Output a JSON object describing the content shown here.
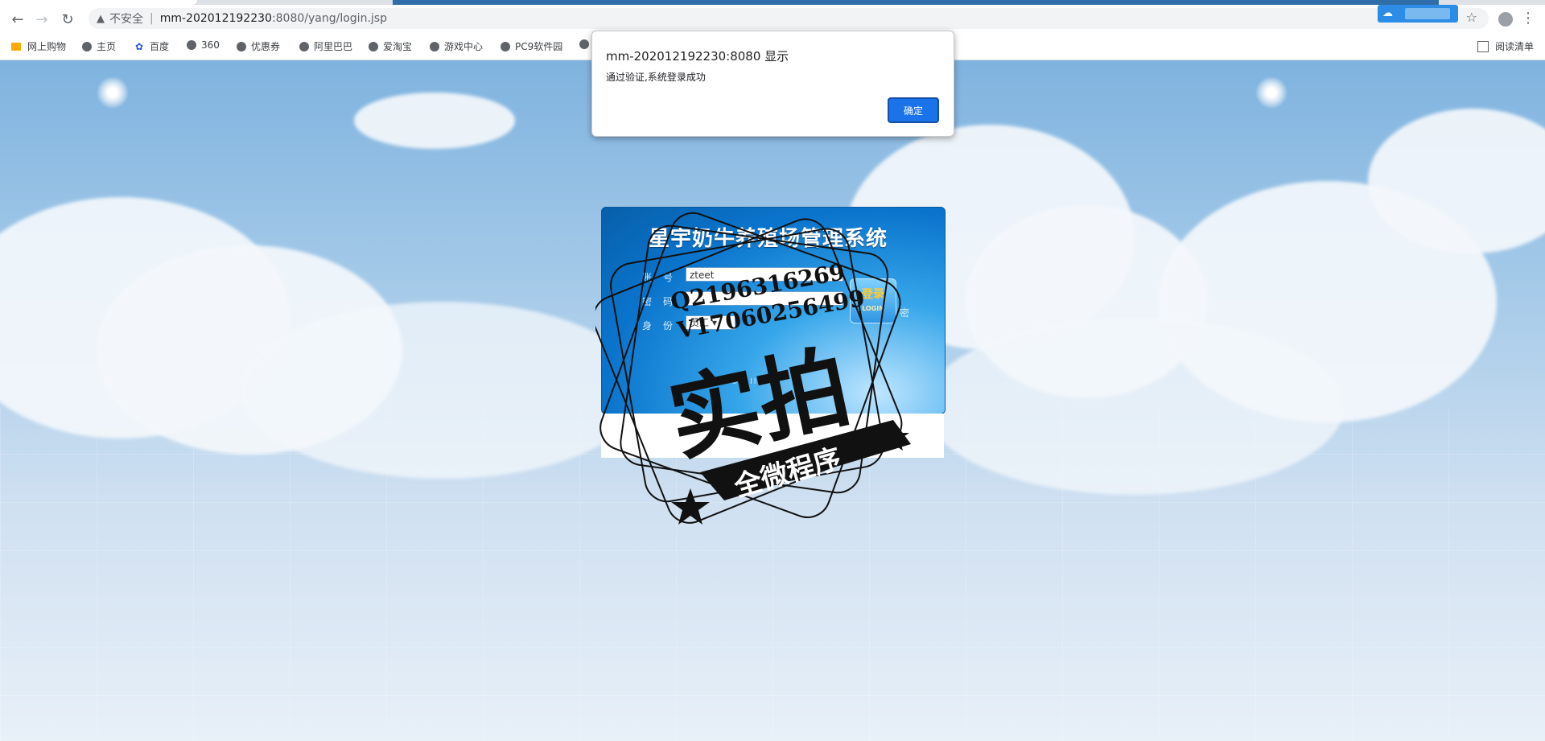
{
  "browser": {
    "security_label": "不安全",
    "url_host": "mm-202012192230",
    "url_path": ":8080/yang/login.jsp",
    "reading_list": "阅读清单"
  },
  "bookmarks": [
    "网上购物",
    "主页",
    "百度",
    "360",
    "优惠券",
    "阿里巴巴",
    "爱淘宝",
    "游戏中心",
    "PC9软件园"
  ],
  "dialog": {
    "title": "mm-202012192230:8080 显示",
    "message": "通过验证,系统登录成功",
    "ok_label": "确定"
  },
  "login": {
    "title": "星宇奶牛养殖场管理系统",
    "account_label": "账号",
    "account_value": "zteet",
    "password_label": "密码",
    "role_label": "身份",
    "role_value": "员工",
    "login_button": "登录",
    "login_button_sub": "LOGIN",
    "reset_label": "密",
    "copyright": "t © All r d."
  },
  "watermark": {
    "line1": "Q2196316269",
    "line2": "V17060256499",
    "big_text": "实拍",
    "banner": "全微程序"
  },
  "colors": {
    "dialog_button": "#1a73e8",
    "panel_blue": "#0a74cc"
  }
}
